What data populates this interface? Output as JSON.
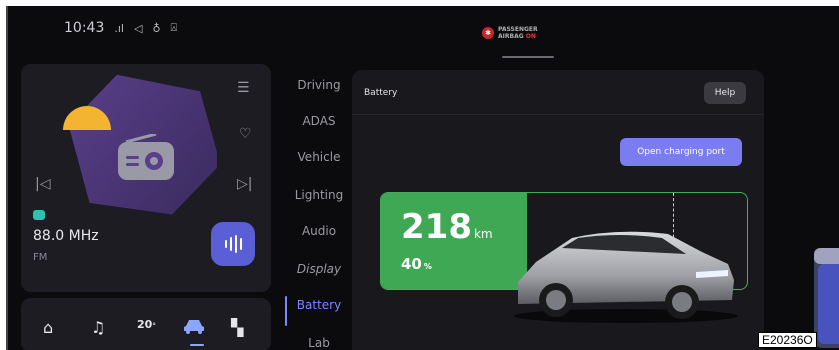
{
  "status_bar": {
    "time": "10:43"
  },
  "airbag": {
    "line1": "PASSENGER",
    "line2": "AIRBAG",
    "state": "ON"
  },
  "media": {
    "frequency": "88.0 MHz",
    "band": "FM",
    "icons": [
      "queue-icon",
      "heart-icon",
      "previous-icon",
      "next-icon",
      "equalizer-icon"
    ]
  },
  "dock": {
    "temperature": "20",
    "icons": [
      "home-icon",
      "music-icon",
      "car-icon",
      "apps-icon"
    ]
  },
  "nav": {
    "items": [
      "Driving",
      "ADAS",
      "Vehicle",
      "Lighting",
      "Audio",
      "Display",
      "Battery",
      "Lab"
    ],
    "active": "Battery"
  },
  "panel": {
    "title": "Battery",
    "help_label": "Help",
    "charge_button": "Open charging port",
    "range_value": "218",
    "range_unit": "km",
    "percent_value": "40",
    "percent_unit": "%",
    "charge_level": 0.4
  },
  "reference_code": "E20236O",
  "colors": {
    "accent": "#7f86ff",
    "battery_green": "#3ea854",
    "airbag_red": "#c62828"
  }
}
